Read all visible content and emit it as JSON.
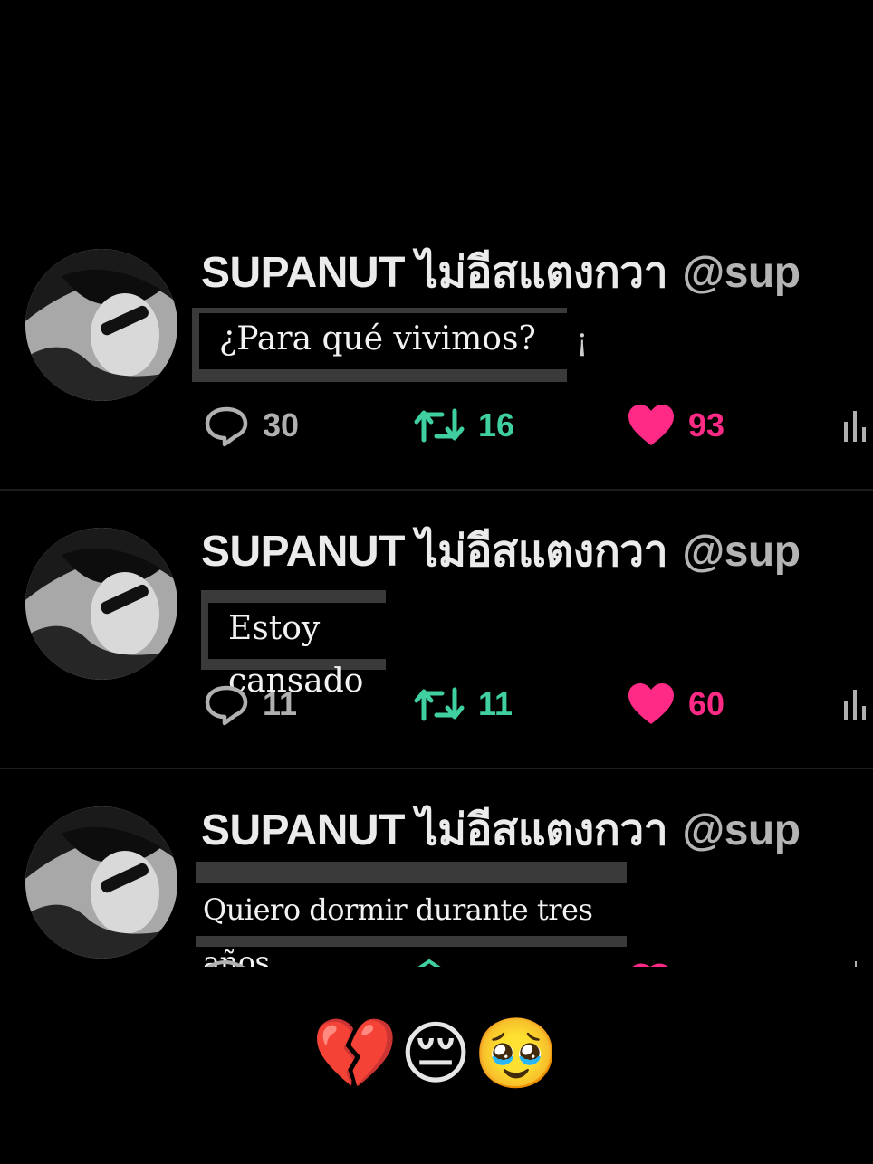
{
  "tweets": [
    {
      "display_name": "SUPANUT ไม่อีสแตงกวา",
      "handle": "@sup",
      "text": "¿Para qué vivimos?",
      "stray_char": "¡",
      "replies": "30",
      "retweets": "16",
      "likes": "93"
    },
    {
      "display_name": "SUPANUT ไม่อีสแตงกวา",
      "handle": "@sup",
      "text": "Estoy cansado",
      "replies": "11",
      "retweets": "11",
      "likes": "60"
    },
    {
      "display_name": "SUPANUT ไม่อีสแตงกวา",
      "handle": "@sup",
      "text": "Quiero dormir durante tres años."
    }
  ],
  "caption_emojis": "💔😔🥹",
  "icons": {
    "reply": "speech-bubble-icon",
    "retweet": "retweet-icon",
    "like": "heart-icon",
    "views": "bar-chart-icon"
  },
  "colors": {
    "background": "#000000",
    "retweet": "#3fcfa0",
    "like": "#ff2a85",
    "muted": "#b0b0b0"
  }
}
